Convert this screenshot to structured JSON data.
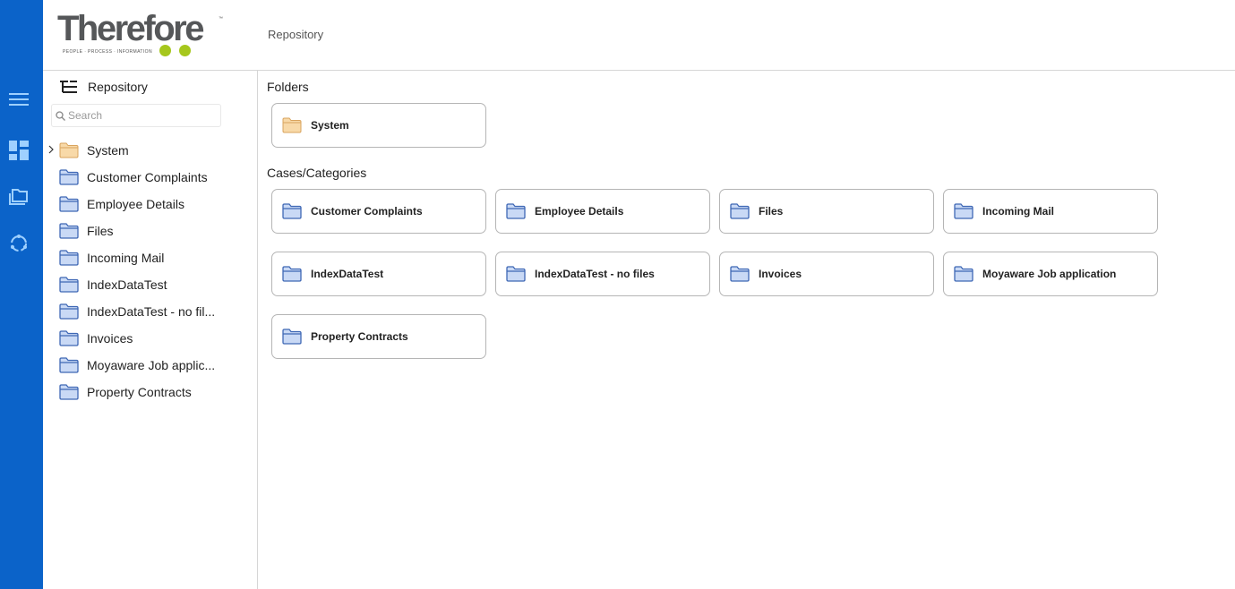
{
  "app": {
    "logo_text": "Therefore",
    "logo_tm": "™",
    "logo_tagline": "PEOPLE · PROCESS · INFORMATION",
    "accent_color": "#0b63c9",
    "logo_dot_color": "#a6c71d"
  },
  "header": {
    "breadcrumb": "Repository"
  },
  "nav_rail": {
    "items": [
      {
        "icon": "hamburger-menu-icon"
      },
      {
        "icon": "dashboard-icon"
      },
      {
        "icon": "folders-icon"
      },
      {
        "icon": "workflow-cycle-icon"
      }
    ]
  },
  "sidebar": {
    "title": "Repository",
    "search_placeholder": "Search",
    "items": [
      {
        "label": "System",
        "type": "folder",
        "expandable": true
      },
      {
        "label": "Customer Complaints",
        "type": "category"
      },
      {
        "label": "Employee Details",
        "type": "category"
      },
      {
        "label": "Files",
        "type": "category"
      },
      {
        "label": "Incoming Mail",
        "type": "category"
      },
      {
        "label": "IndexDataTest",
        "type": "category"
      },
      {
        "label": "IndexDataTest - no fil...",
        "type": "category"
      },
      {
        "label": "Invoices",
        "type": "category"
      },
      {
        "label": "Moyaware Job applic...",
        "type": "category"
      },
      {
        "label": "Property Contracts",
        "type": "category"
      }
    ]
  },
  "main": {
    "folders_title": "Folders",
    "folders": [
      {
        "label": "System"
      }
    ],
    "categories_title": "Cases/Categories",
    "categories": [
      {
        "label": "Customer Complaints"
      },
      {
        "label": "Employee Details"
      },
      {
        "label": "Files"
      },
      {
        "label": "Incoming Mail"
      },
      {
        "label": "IndexDataTest"
      },
      {
        "label": "IndexDataTest - no files"
      },
      {
        "label": "Invoices"
      },
      {
        "label": "Moyaware Job application"
      },
      {
        "label": "Property Contracts"
      }
    ]
  }
}
